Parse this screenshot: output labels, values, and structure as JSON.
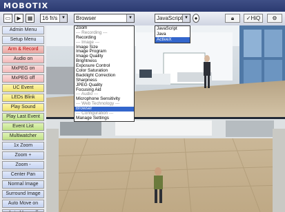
{
  "brand": {
    "name": "MOBOTIX"
  },
  "toolbar": {
    "rate_value": "16 fr/s",
    "viewer_select": "Browser",
    "tech_select": "JavaScript",
    "hiq_label": "HiQ",
    "arrow": "▼"
  },
  "sidebar": {
    "buttons": [
      "Admin Menu",
      "Setup Menu",
      "Arm & Record",
      "Audio on",
      "MxPEG on",
      "MxPEG off",
      "UC Event",
      "LEDs Blink",
      "Play Sound",
      "Play Last Event",
      "Event List",
      "Multiwatcher",
      "1x Zoom",
      "Zoom +",
      "Zoom -",
      "Center Pan",
      "Normal Image",
      "Surround Image",
      "Auto Move on",
      "Auto Move off"
    ]
  },
  "menu": {
    "items": [
      "Zoom",
      "--- Recording ---",
      "Recording",
      "--- Image ---",
      "Image Size",
      "Image Program",
      "Image Quality",
      "Brightness",
      "Exposure Control",
      "Color Saturation",
      "Backlight Correction",
      "Sharpness",
      "JPEG Quality",
      "Focusing Aid",
      "--- Audio ---",
      "Microphone Sensitivity",
      "--- Web Technology ---",
      "Browser",
      "--- Configuration ---",
      "Manage Settings"
    ]
  },
  "menu2": {
    "items": [
      "JavaScript",
      "Java",
      "ActiveX"
    ]
  },
  "colors": {
    "title_bar": "#2f3e78",
    "highlight": "#3366cc",
    "floor": "#c9b79a"
  }
}
